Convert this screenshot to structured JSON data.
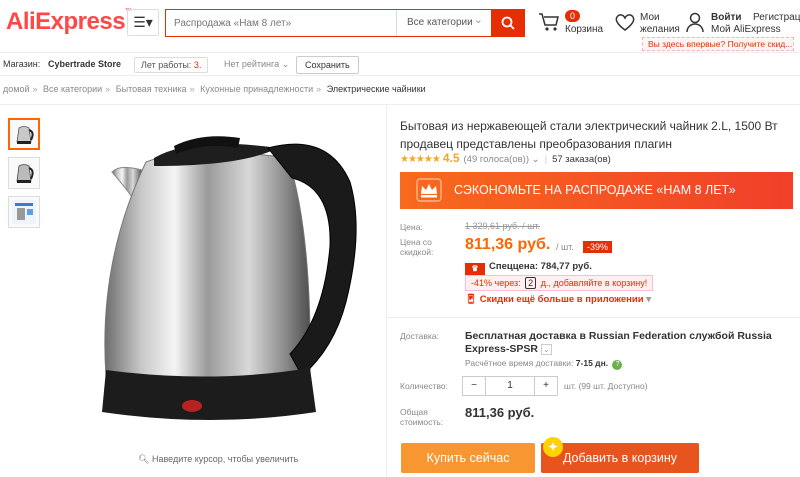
{
  "header": {
    "logo": "AliExpress",
    "search_placeholder": "Распродажа «Нам 8 лет»",
    "search_category": "Все категории",
    "cart_count": "0",
    "cart_label": "Корзина",
    "wishlist_label": "Мои желания",
    "login": "Войти",
    "register": "Регистрация",
    "my_account": "Мой AliExpress",
    "first_visit_tip": "Вы здесь впервые? Получите скид..."
  },
  "store": {
    "label": "Магазин:",
    "name": "Cybertrade Store",
    "years_label": "Лет работы:",
    "years": "3",
    "rating": "Нет рейтинга",
    "save": "Сохранить"
  },
  "breadcrumb": [
    "домой",
    "Все категории",
    "Бытовая техника",
    "Кухонные принадлежности",
    "Электрические чайники"
  ],
  "gallery": {
    "zoom_hint": "Наведите курсор, чтобы увеличить"
  },
  "product": {
    "title": "Бытовая из нержавеющей стали электрический чайник 2.L, 1500 Вт продавец представлены преобразования плагин",
    "rating_stars": 4.5,
    "rating": "4.5",
    "votes": "(49 голоса(ов))",
    "orders": "57 заказа(ов)",
    "sale_banner": "СЭКОНОМЬТЕ НА РАСПРОДАЖЕ «НАМ 8 ЛЕТ»",
    "price_label": "Цена:",
    "price_old": "1 329,61 руб. / шт.",
    "discount_price_label": "Цена со скидкой:",
    "price_now": "811,36 руб.",
    "price_unit": "/ шт.",
    "discount": "-39%",
    "special_label": "Спеццена: 784,77 руб.",
    "coupon_pre": "-41% через:",
    "coupon_days": "2",
    "coupon_post": "д., добавляйте в корзину!",
    "app_deal": "Скидки ещё больше в приложении",
    "shipping_label": "Доставка:",
    "shipping": "Бесплатная доставка в Russian Federation службой Russia Express-SPSR",
    "eta_label": "Расчётное время доставки:",
    "eta": "7-15 дн.",
    "qty_label": "Количество:",
    "qty": "1",
    "qty_note": "шт. (99 шт. Доступно)",
    "total_label": "Общая стоимость:",
    "total": "811,36 руб.",
    "buy_now": "Купить сейчас",
    "add_to_cart": "Добавить в корзину"
  },
  "colors": {
    "brand": "#ff4747",
    "accent": "#e62e04",
    "price": "#ff6600",
    "buy": "#f89631",
    "cart": "#e8541e"
  }
}
